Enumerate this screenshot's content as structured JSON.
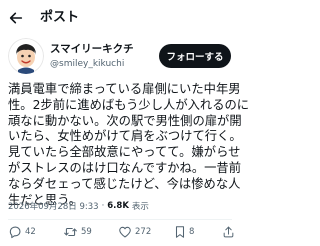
{
  "header": {
    "title": "ポスト"
  },
  "author": {
    "display_name": "スマイリーキクチ",
    "handle": "@smiley_kikuchi",
    "follow_label": "フォローする"
  },
  "post": {
    "lines": [
      "満員電車で締まっている扉側にいた中年男",
      "性。2步前に進めばもう少し人が入れるのに",
      "頑なに動かない。次の駅で男性側の扉が開",
      "いたら、女性めがけて肩をぶつけて行く。",
      "見ていたら全部故意にやってて。嫌がらせ",
      "がストレスのはけ口なんですかね。一昔前",
      "ならダセェって感じたけど、今は惨めな人",
      "生だと思う。"
    ],
    "timestamp": "2026年09月28日 9:33",
    "separator": "·",
    "views_count": "6.8K",
    "views_label": "表示"
  },
  "actions": {
    "replies": "42",
    "reposts": "59",
    "likes": "272",
    "bookmarks": "8"
  },
  "colors": {
    "text": "#0f1419",
    "secondary": "#536471",
    "follow_button_bg": "#0f1419",
    "follow_button_text": "#ffffff",
    "divider": "#eff3f4"
  }
}
